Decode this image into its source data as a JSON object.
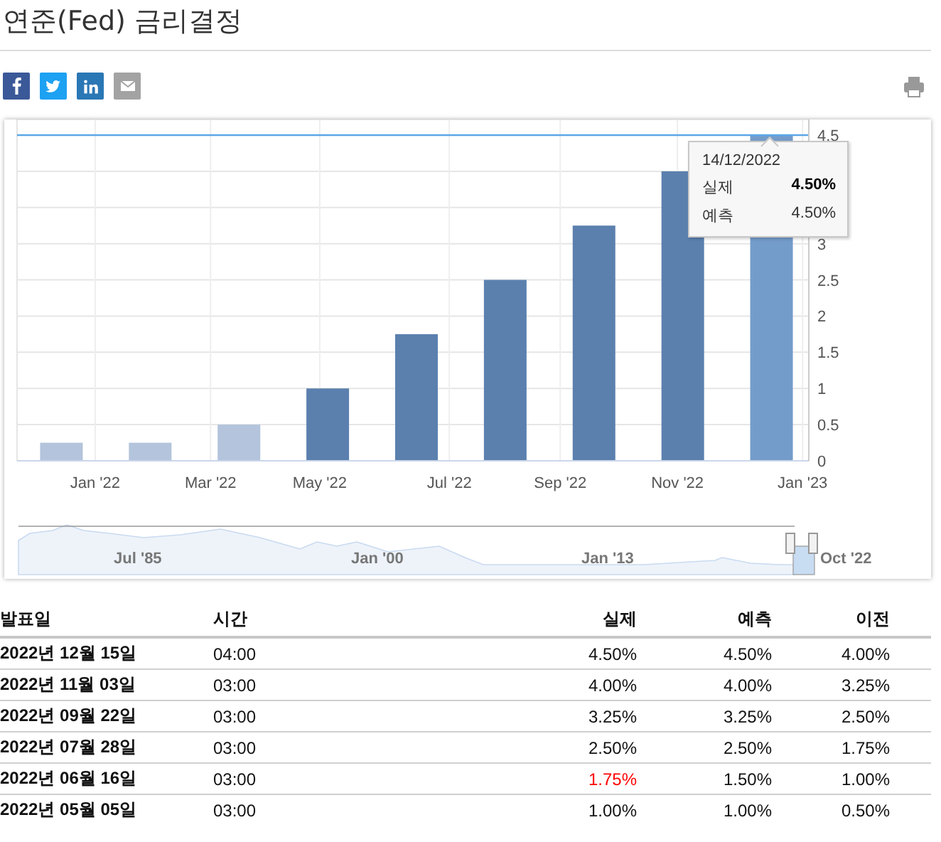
{
  "title": "연준(Fed) 금리결정",
  "share_buttons": [
    {
      "kind": "facebook"
    },
    {
      "kind": "twitter"
    },
    {
      "kind": "linkedin"
    },
    {
      "kind": "email"
    }
  ],
  "chart": {
    "chart_data": {
      "type": "bar",
      "categories": [
        null,
        null,
        null,
        null,
        null,
        null,
        null,
        null,
        null
      ],
      "series": [
        {
          "color": "#b3c4dc",
          "values": [
            0.25,
            0.25,
            0.5,
            null,
            null,
            null,
            null,
            null,
            null
          ]
        },
        {
          "color": "#5b80ae",
          "values": [
            null,
            null,
            null,
            1.0,
            1.75,
            2.5,
            3.25,
            4.0,
            null
          ]
        },
        {
          "color": "#749cca",
          "values": [
            null,
            null,
            null,
            null,
            null,
            null,
            null,
            null,
            4.5
          ]
        }
      ],
      "ylim": [
        0,
        4.5
      ],
      "grid": true,
      "yticks": [
        0,
        0.5,
        1,
        1.5,
        2,
        2.5,
        3,
        4.5
      ]
    },
    "x_axis_labels": [
      "Jan '22",
      "Mar '22",
      "May '22",
      "Jul '22",
      "Sep '22",
      "Nov '22",
      "Jan '23"
    ],
    "tooltip": {
      "date": "14/12/2022",
      "rows": [
        {
          "label": "실제",
          "value": "4.50%",
          "emphasized": true
        },
        {
          "label": "예측",
          "value": "4.50%",
          "emphasized": false
        }
      ]
    },
    "navigator_labels": [
      "Jul '85",
      "Jan '00",
      "Jan '13",
      "Oct '22"
    ]
  },
  "table": {
    "columns": [
      "발표일",
      "시간",
      "실제",
      "예측",
      "이전"
    ],
    "rows": [
      {
        "date": "2022년 12월 15일",
        "time": "04:00",
        "actual": "4.50%",
        "actual_highlighted": false,
        "forecast": "4.50%",
        "previous": "4.00%"
      },
      {
        "date": "2022년 11월 03일",
        "time": "03:00",
        "actual": "4.00%",
        "actual_highlighted": false,
        "forecast": "4.00%",
        "previous": "3.25%"
      },
      {
        "date": "2022년 09월 22일",
        "time": "03:00",
        "actual": "3.25%",
        "actual_highlighted": false,
        "forecast": "3.25%",
        "previous": "2.50%"
      },
      {
        "date": "2022년 07월 28일",
        "time": "03:00",
        "actual": "2.50%",
        "actual_highlighted": false,
        "forecast": "2.50%",
        "previous": "1.75%"
      },
      {
        "date": "2022년 06월 16일",
        "time": "03:00",
        "actual": "1.75%",
        "actual_highlighted": true,
        "forecast": "1.50%",
        "previous": "1.00%"
      },
      {
        "date": "2022년 05월 05일",
        "time": "03:00",
        "actual": "1.00%",
        "actual_highlighted": false,
        "forecast": "1.00%",
        "previous": "0.50%"
      }
    ]
  }
}
